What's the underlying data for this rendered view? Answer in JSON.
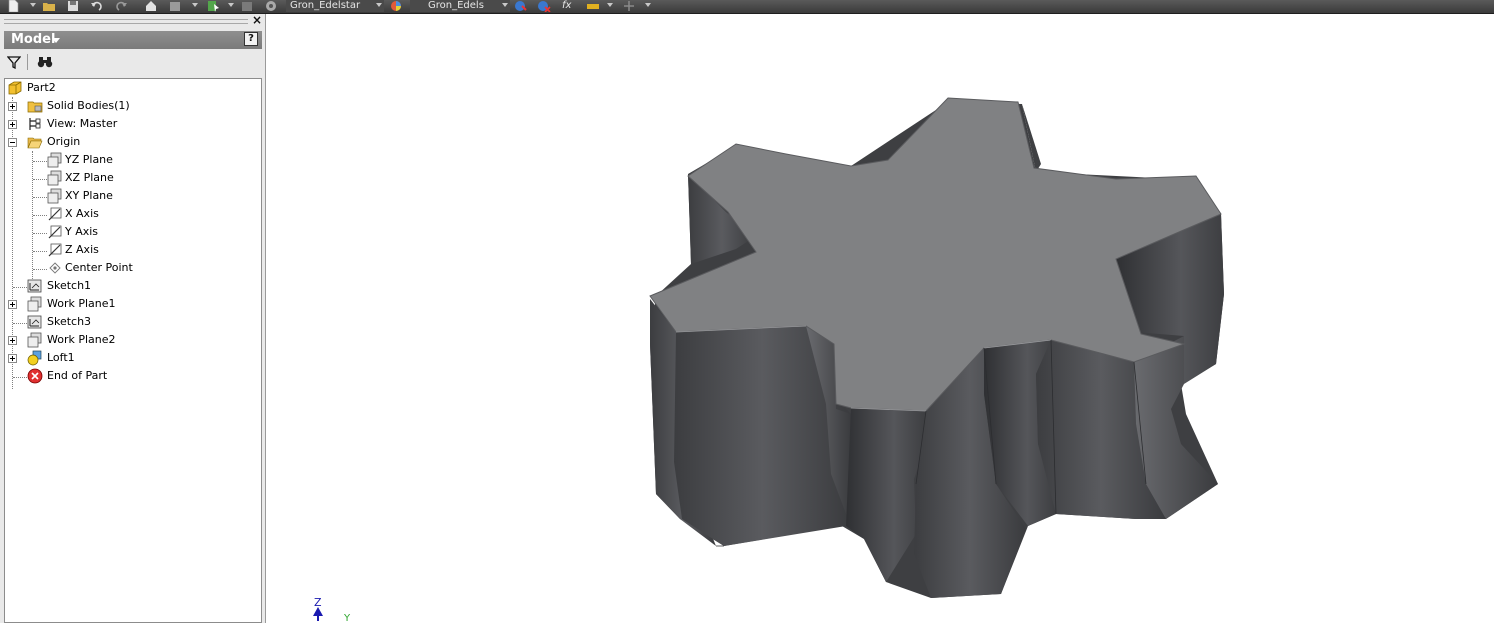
{
  "toolbar": {
    "material_combo": "Gron_Edelstar",
    "appearance_combo": "Gron_Edels",
    "function_glyph": "fx"
  },
  "browser": {
    "title": "Model",
    "close_glyph": "×",
    "help_glyph": "?",
    "tree": {
      "root": "Part2",
      "items": [
        {
          "label": "Solid Bodies(1)",
          "icon": "solid-bodies-icon",
          "expandable": true,
          "expanded": false
        },
        {
          "label": "View: Master",
          "icon": "view-rep-icon",
          "expandable": true,
          "expanded": false
        },
        {
          "label": "Origin",
          "icon": "folder-open-icon",
          "expandable": true,
          "expanded": true
        },
        {
          "label": "Sketch1",
          "icon": "sketch-icon",
          "expandable": false
        },
        {
          "label": "Work Plane1",
          "icon": "work-plane-icon",
          "expandable": true,
          "expanded": false
        },
        {
          "label": "Sketch3",
          "icon": "sketch-icon",
          "expandable": false
        },
        {
          "label": "Work Plane2",
          "icon": "work-plane-icon",
          "expandable": true,
          "expanded": false
        },
        {
          "label": "Loft1",
          "icon": "loft-icon",
          "expandable": true,
          "expanded": false
        },
        {
          "label": "End of Part",
          "icon": "end-of-part-icon",
          "expandable": false
        }
      ],
      "origin_children": [
        {
          "label": "YZ Plane",
          "icon": "plane-icon"
        },
        {
          "label": "XZ Plane",
          "icon": "plane-icon"
        },
        {
          "label": "XY Plane",
          "icon": "plane-icon"
        },
        {
          "label": "X Axis",
          "icon": "axis-icon"
        },
        {
          "label": "Y Axis",
          "icon": "axis-icon"
        },
        {
          "label": "Z Axis",
          "icon": "axis-icon"
        },
        {
          "label": "Center Point",
          "icon": "center-point-icon"
        }
      ]
    }
  },
  "viewport": {
    "triad": {
      "z_label": "Z",
      "y_label": "Y"
    }
  },
  "colors": {
    "toolbar_bg": "#4a4a4a",
    "panel_bg": "#e9e9e9",
    "panel_header": "#858585",
    "model_top": "#808183",
    "model_side": "#4a4b4e",
    "triad_z": "#1a1ab0",
    "triad_y": "#2ea62e"
  }
}
